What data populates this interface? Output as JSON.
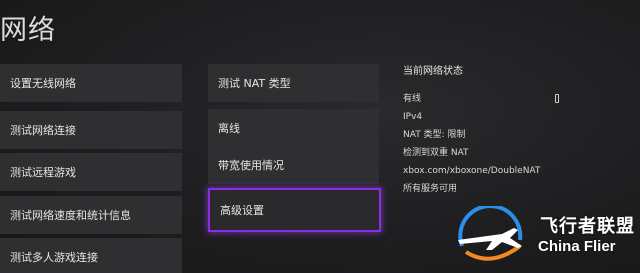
{
  "page": {
    "title": "网络"
  },
  "menu_left": [
    {
      "label": "设置无线网络"
    },
    {
      "label": "测试网络连接"
    },
    {
      "label": "测试远程游戏"
    },
    {
      "label": "测试网络速度和统计信息"
    },
    {
      "label": "测试多人游戏连接"
    }
  ],
  "menu_right": [
    {
      "label": "测试 NAT 类型"
    },
    {
      "label": "离线"
    },
    {
      "label": "带宽使用情况"
    },
    {
      "label": "高级设置",
      "selected": true
    }
  ],
  "status": {
    "heading": "当前网络状态",
    "connection": "有线",
    "ip_version": "IPv4",
    "nat_type": "NAT 类型: 限制",
    "double_nat": "检测到双重 NAT",
    "help_url": "xbox.com/xboxone/DoubleNAT",
    "services": "所有服务可用",
    "connection_icon": "ethernet-icon"
  },
  "watermark": {
    "chinese": "飞行者联盟",
    "english": "China Flier",
    "logo_icon": "airplane-logo-icon"
  },
  "colors": {
    "selection_border": "#8a2fe0",
    "tile_background": "#2f2f31",
    "background": "#1e1e20",
    "logo_blue": "#2b8ee8",
    "logo_orange": "#f08a24"
  }
}
